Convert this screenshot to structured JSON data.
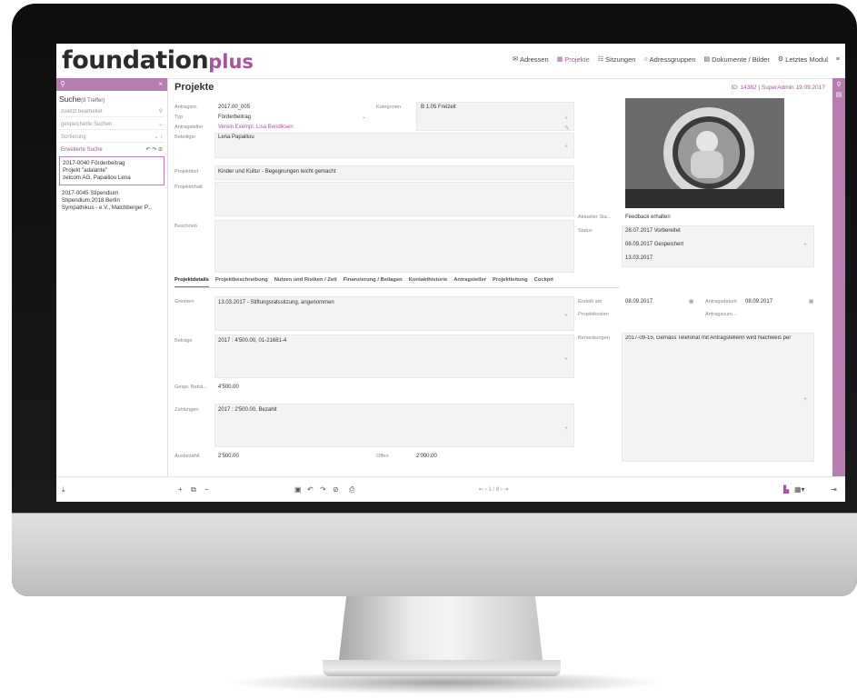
{
  "app": {
    "logo_main": "foundation",
    "logo_plus": "plus"
  },
  "nav": [
    {
      "label": "Adressen",
      "icon": "envelope-icon"
    },
    {
      "label": "Projekte",
      "icon": "grid-icon",
      "active": true
    },
    {
      "label": "Sitzungen",
      "icon": "group-icon"
    },
    {
      "label": "Adressgruppen",
      "icon": "circle-icon"
    },
    {
      "label": "Dokumente / Bilder",
      "icon": "document-icon"
    },
    {
      "label": "Letztes Modul",
      "icon": "gear-icon"
    }
  ],
  "search": {
    "title": "Suche",
    "count": "(8 Treffer)",
    "placeholder": "zuletzt bearbeitet",
    "saved": "gespeicherte Suchen",
    "sort": "Sortierung",
    "advanced": "Erweiterte Suche",
    "results": [
      {
        "lines": [
          "2017-0040 Förderbeitrag",
          "Projekt \"adalante\"",
          "zetcom AG, Papailiou Lena"
        ]
      },
      {
        "lines": [
          "2017-0045 Stipendium",
          "Stipendium 2018 Berlin",
          "Sympathikus - e.V., Malchberger P..."
        ]
      }
    ]
  },
  "page": {
    "title": "Projekte",
    "id_line": "ID: 14382 | SuperAdmin 19.09.2017"
  },
  "form": {
    "antragsnr_label": "Antragsnr.",
    "antragsnr": "2017.00_005",
    "kategorien_label": "Kategorien",
    "kategorie": "B 1.05 Freizeit",
    "typ_label": "Typ",
    "typ": "Förderbeitrag",
    "antragsteller_label": "Antragsteller",
    "antragsteller": "Verein Exempl. Lisa Bendiksen",
    "beteiligte_label": "Beteiligte",
    "beteiligte": "Lena Papailiou",
    "projekttitel_label": "Projekttitel",
    "projekttitel": "Kinder und Kultur - Begegnungen leicht gemacht",
    "projektinhalt_label": "Projektinhalt",
    "beschrieb_label": "Beschrieb",
    "aktueller_status_label": "Aktueller Sta...",
    "aktueller_status": "Feedback erhalten",
    "status_label": "Status",
    "status_entries": [
      "28.07.2017 Vorbereitet",
      "08.09.2017 Gespeichert",
      "13.03.2017"
    ]
  },
  "tabs": [
    "Projektdetails",
    "Projektbeschreibung",
    "Nutzen und Risiken / Zeit",
    "Finanzierung / Beilagen",
    "Kontakthistorie",
    "Antragsteller",
    "Projektleitung",
    "Cockpit"
  ],
  "details": {
    "gremien_label": "Gremien",
    "gremien": "13.03.2017 - Stiftungsratssitzung, angenommen",
    "betraege_label": "Beträge",
    "betraege": "2017 : 4'500.00, 01-21681-4",
    "gespr_label": "Gespr. Beträ...",
    "gespr": "4'500.00",
    "zahlungen_label": "Zahlungen",
    "zahlungen": "2017 : 2'500.00, Bezahlt",
    "ausbezahlt_label": "Ausbezahlt",
    "ausbezahlt": "2'500.00",
    "offen_label": "Offen",
    "offen": "2'000.00",
    "erstellt_label": "Erstellt am",
    "erstellt": "08.09.2017",
    "antragsdatum_label": "Antragsdatum",
    "antragsdatum": "08.09.2017",
    "projektkosten_label": "Projektkosten",
    "antragssumme_label": "Antragssum...",
    "bemerkungen_label": "Bemerkungen",
    "bemerkungen": "2017-09-15, Gemäss Telefonat mit Antragstellerin wird Nachweis per"
  },
  "pager": "1 / 8",
  "colors": {
    "accent": "#a3579c",
    "accent_light": "#b77cb0"
  }
}
